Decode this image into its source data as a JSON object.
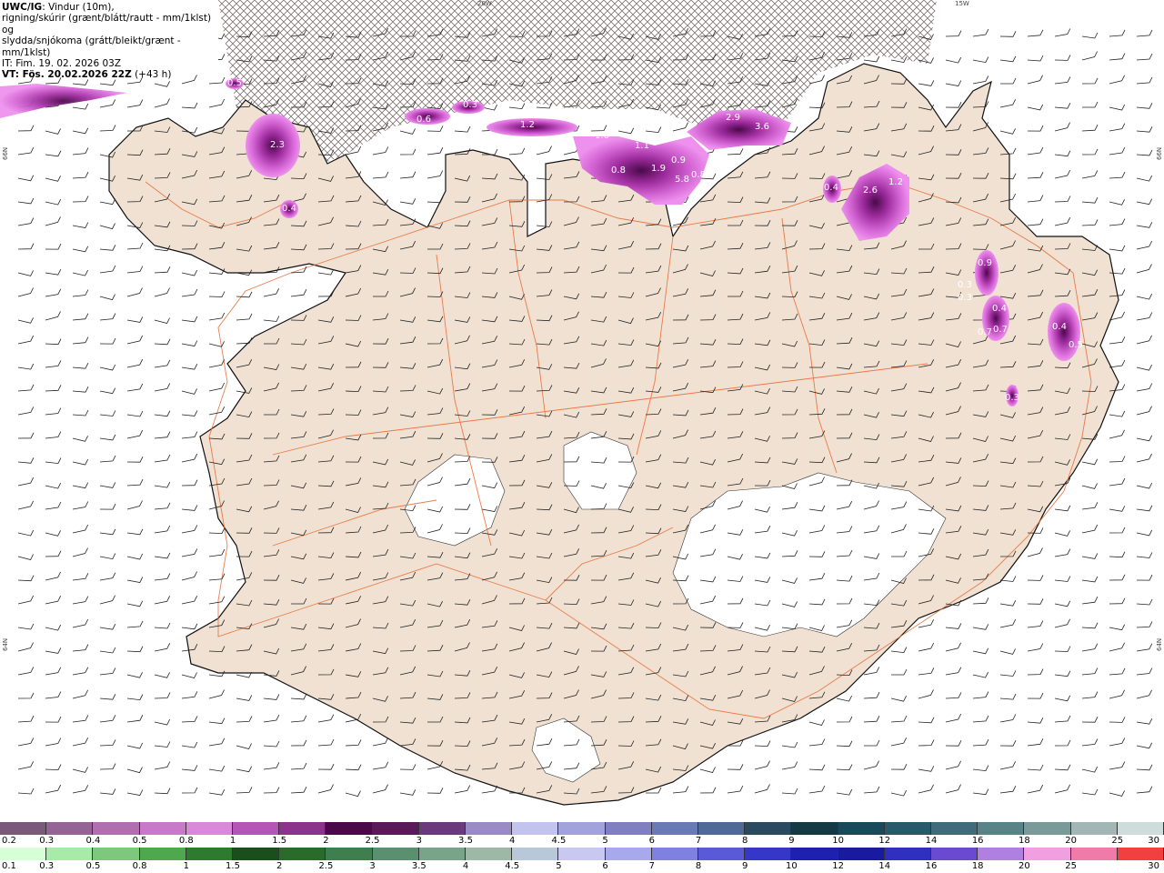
{
  "header": {
    "title_bold": "UWC/IG",
    "title_rest": ": Vindur (10m),",
    "line2": "rigning/skúrir (grænt/blátt/rautt - mm/1klst) og",
    "line3": "slydda/snjókoma (grátt/bleikt/grænt - mm/1klst)",
    "it": "IT: Fim. 19. 02. 2026 03Z",
    "vt_bold": "VT: Fös. 20.02.2026 22Z",
    "vt_rest": "(+43 h)"
  },
  "grid_labels": {
    "top_20w": "20W",
    "top_15w": "15W",
    "left_66n": "66N",
    "left_64n": "64N",
    "right_66n": "66N",
    "right_64n": "64N"
  },
  "precip_labels": [
    "0.5",
    "2.3",
    "0.4",
    "0.6",
    "0.3",
    "1.2",
    "1.0",
    "1.1",
    "0.8",
    "1.9",
    "0.9",
    "5.8",
    "0.8",
    "2.9",
    "3.6",
    "0.4",
    "2.6",
    "1.2",
    "0.9",
    "0.3",
    "0.3",
    "0.4",
    "0.7",
    "0.7",
    "0.4",
    "0.5",
    "0.3"
  ],
  "scale_top": {
    "colors": [
      "#7a5a7a",
      "#946594",
      "#b070b0",
      "#c77ac7",
      "#d88ad8",
      "#b555b5",
      "#8a358a",
      "#4a0a4a",
      "#5a1a5a",
      "#6a3a7a",
      "#9b8bc4",
      "#c3c3f0",
      "#a3a3dc",
      "#8080c0",
      "#6a7ab4",
      "#4f6a94",
      "#2a4a60",
      "#143a44",
      "#1a4a5a",
      "#2a5a6a",
      "#3f6b7a",
      "#588488",
      "#7a9a9a",
      "#a3b6b6",
      "#cfdcdc"
    ],
    "ticks": [
      "0.2",
      "0.3",
      "0.4",
      "0.5",
      "0.8",
      "1",
      "1.5",
      "2",
      "2.5",
      "3",
      "3.5",
      "4",
      "4.5",
      "5",
      "6",
      "7",
      "8",
      "9",
      "10",
      "12",
      "14",
      "16",
      "18",
      "20",
      "25",
      "30"
    ]
  },
  "scale_bottom": {
    "colors": [
      "#d6ffd6",
      "#a8eaa8",
      "#7ec87e",
      "#4ea84e",
      "#2e7a2e",
      "#1a4e1a",
      "#2a6a2a",
      "#3f7f4f",
      "#5a8f6f",
      "#7aa48a",
      "#9eb8a8",
      "#b8c8d8",
      "#c8c8f0",
      "#a8a8ec",
      "#8080e0",
      "#5a5ad8",
      "#3636c8",
      "#2020b0",
      "#1a1aa0",
      "#3030c0",
      "#6a4ad0",
      "#b080e0",
      "#f0a0e0",
      "#f07aa8",
      "#f04040"
    ],
    "ticks": [
      "0.1",
      "0.3",
      "0.5",
      "0.8",
      "1",
      "1.5",
      "2",
      "2.5",
      "3",
      "3.5",
      "4",
      "4.5",
      "5",
      "6",
      "7",
      "8",
      "9",
      "10",
      "12",
      "14",
      "16",
      "18",
      "20",
      "25",
      "30"
    ]
  },
  "colors": {
    "land": "#f0e1d2",
    "coast": "#111111",
    "roads": "#e8703a",
    "sea": "#ffffff",
    "precip_light": "#ee7aee",
    "precip_dark": "#8a1a8a"
  }
}
